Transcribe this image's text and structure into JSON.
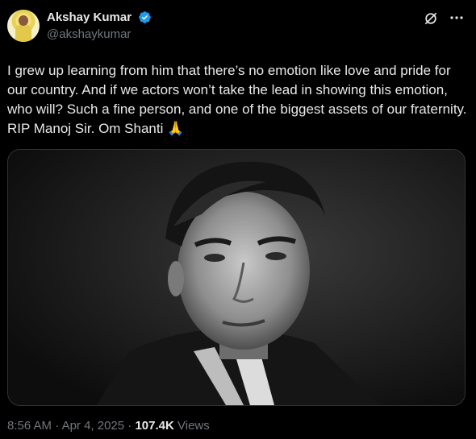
{
  "author": {
    "display_name": "Akshay Kumar",
    "handle": "@akshaykumar",
    "verified": true,
    "verified_color": "#1d9bf0",
    "avatar_icon": "avatar-photo"
  },
  "actions": {
    "grok_icon": "grok-icon",
    "more_icon": "more-icon"
  },
  "tweet": {
    "text": "I grew up learning from him that there’s no emotion like love and pride for our country. And if we actors won’t take the lead in showing this emotion, who will? Such a fine person, and one of the biggest assets of our fraternity. RIP Manoj Sir. Om Shanti 🙏"
  },
  "meta": {
    "time": "8:56 AM",
    "sep1": " · ",
    "date": "Apr 4, 2025",
    "sep2": " · ",
    "views_count": "107.4K",
    "views_label": " Views"
  },
  "colors": {
    "background": "#000000",
    "text": "#e7e9ea",
    "secondary": "#71767b",
    "accent": "#1d9bf0"
  }
}
